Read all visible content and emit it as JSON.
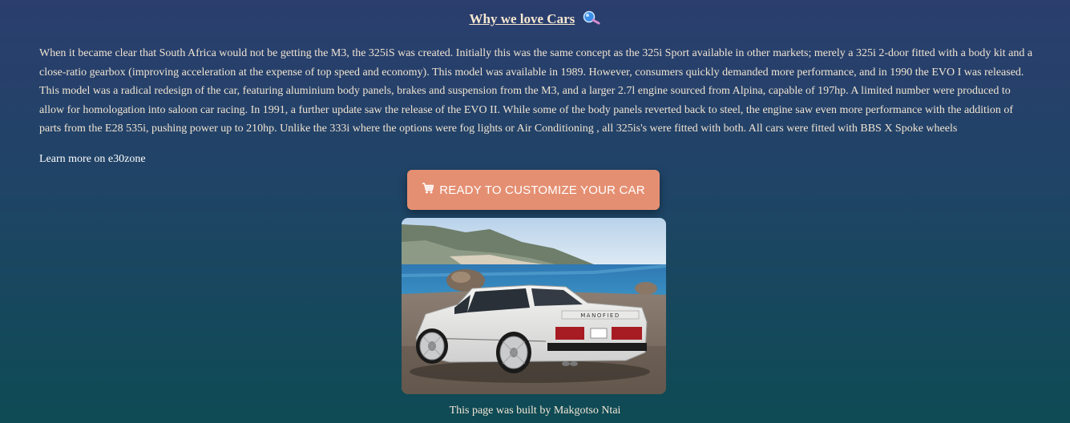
{
  "heading": {
    "title": "Why we love Cars",
    "icon": "magnifier-icon"
  },
  "intro": {
    "text": "When it became clear that South Africa would not be getting the M3, the 325iS was created. Initially this was the same concept as the 325i Sport available in other markets; merely a 325i 2-door fitted with a body kit and a close-ratio gearbox (improving acceleration at the expense of top speed and economy). This model was available in 1989. However, consumers quickly demanded more performance, and in 1990 the EVO I was released. This model was a radical redesign of the car, featuring aluminium body panels, brakes and suspension from the M3, and a larger 2.7l engine sourced from Alpina, capable of 197hp. A limited number were produced to allow for homologation into saloon car racing. In 1991, a further update saw the release of the EVO II. While some of the body panels reverted back to steel, the engine saw even more performance with the addition of parts from the E28 535i, pushing power up to 210hp. Unlike the 333i where the options were fog lights or Air Conditioning , all 325is's were fitted with both. All cars were fitted with BBS X Spoke wheels"
  },
  "links": {
    "learn_more": "Learn more on e30zone"
  },
  "cta": {
    "label": "READY TO CUSTOMIZE YOUR CAR",
    "icon": "shopping-cart-icon"
  },
  "photo": {
    "plate_text": "MANOFIED"
  },
  "footer": {
    "text": "This page was built by Makgotso Ntai"
  },
  "colors": {
    "background_top": "#2b3e6e",
    "background_bottom": "#0e4b54",
    "button": "#e58f72",
    "text": "#f3e6d6"
  }
}
